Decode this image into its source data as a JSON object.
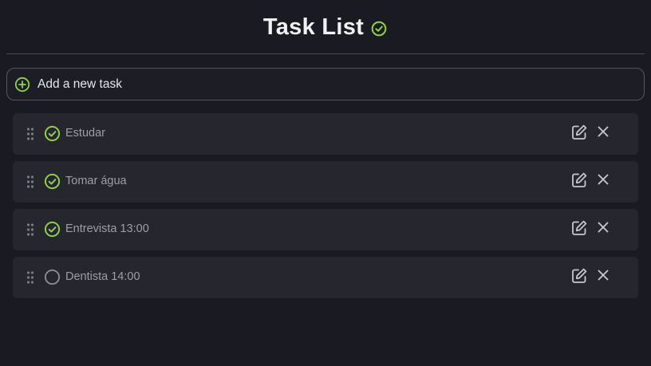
{
  "header": {
    "title": "Task List",
    "title_icon": "check-circle-icon"
  },
  "add_task": {
    "label": "Add a new task",
    "icon": "plus-circle-icon"
  },
  "tasks": [
    {
      "text": "Estudar",
      "done": true
    },
    {
      "text": "Tomar água",
      "done": true
    },
    {
      "text": "Entrevista 13:00",
      "done": true
    },
    {
      "text": "Dentista 14:00",
      "done": false
    }
  ],
  "icons": {
    "drag": "drag-handle-icon",
    "edit": "edit-icon",
    "delete": "close-icon"
  },
  "colors": {
    "background": "#1a1b22",
    "card": "#25262e",
    "accent": "#8ed43b",
    "text_primary": "#f2f2f4",
    "text_task": "#9d9ea6",
    "icon_muted": "#c6c7cd"
  }
}
